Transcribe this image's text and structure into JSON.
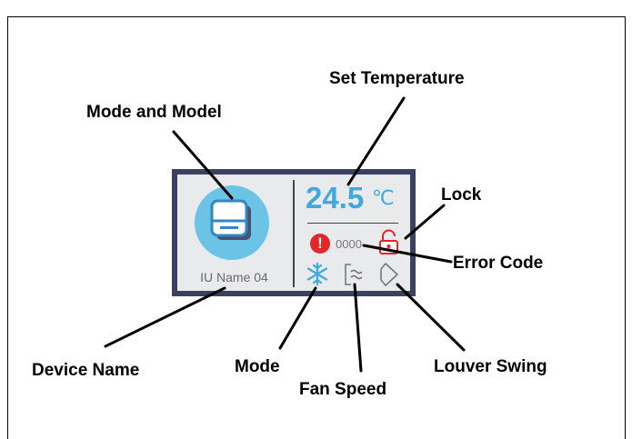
{
  "device": {
    "name": "IU Name 04",
    "set_temperature": "24.5",
    "temperature_unit": "℃",
    "error_code": "0000",
    "error_icon": "!",
    "mode_icon": "snowflake-icon",
    "fan_icon": "fan-speed-icon",
    "louver_icon": "louver-swing-icon",
    "lock_icon": "lock-icon"
  },
  "labels": {
    "mode_and_model": "Mode and Model",
    "set_temperature": "Set Temperature",
    "lock": "Lock",
    "error_code": "Error Code",
    "device_name": "Device Name",
    "mode": "Mode",
    "fan_speed": "Fan Speed",
    "louver_swing": "Louver Swing"
  },
  "colors": {
    "card_border": "#3b4160",
    "card_background": "#e9eaec",
    "accent_blue": "#3ea8e0",
    "circle_blue": "#6bc4e6",
    "error_red": "#e32626"
  }
}
